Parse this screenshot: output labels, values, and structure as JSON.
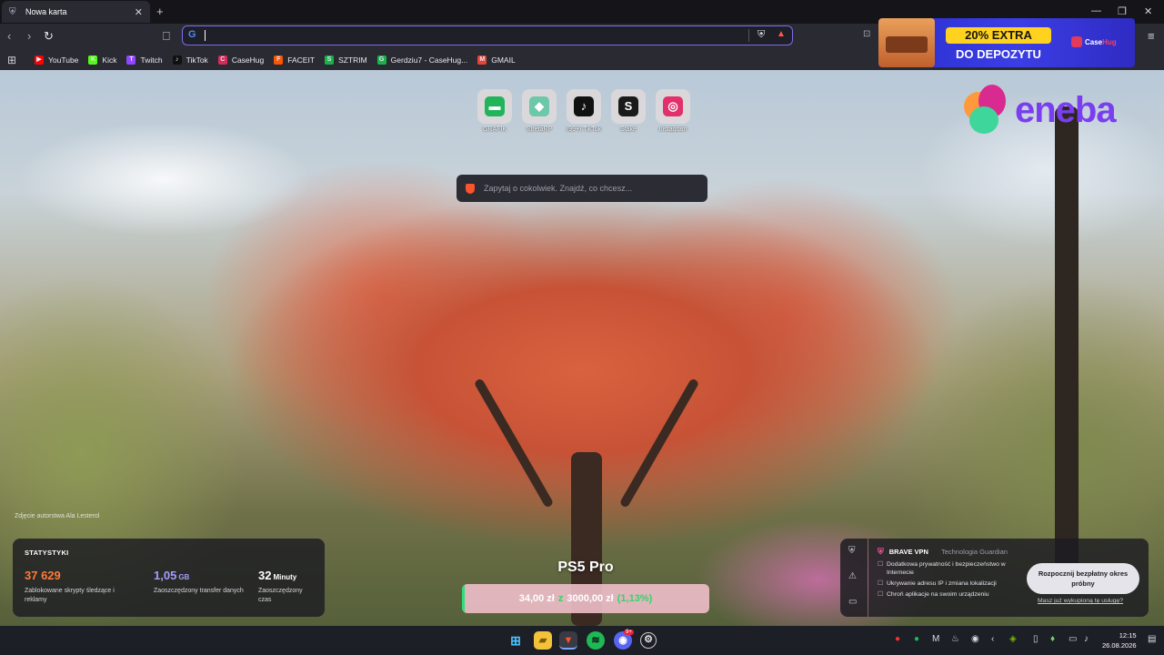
{
  "tab": {
    "title": "Nowa karta",
    "close": "✕",
    "new": "+"
  },
  "window": {
    "minimize": "—",
    "maximize": "❐",
    "close": "✕"
  },
  "bookmarks": [
    {
      "label": "YouTube",
      "color": "#ff0000",
      "glyph": "▶"
    },
    {
      "label": "Kick",
      "color": "#53fc18",
      "glyph": "K"
    },
    {
      "label": "Twitch",
      "color": "#9146ff",
      "glyph": "T"
    },
    {
      "label": "TikTok",
      "color": "#111111",
      "glyph": "♪"
    },
    {
      "label": "CaseHug",
      "color": "#d62a5a",
      "glyph": "C"
    },
    {
      "label": "FACEIT",
      "color": "#ff5500",
      "glyph": "F"
    },
    {
      "label": "SZTRIM",
      "color": "#19b34a",
      "glyph": "S"
    },
    {
      "label": "Gerdziu7 - CaseHug...",
      "color": "#19b34a",
      "glyph": "G"
    },
    {
      "label": "GMAIL",
      "color": "#ea4335",
      "glyph": "M"
    }
  ],
  "ad": {
    "badge": "20% EXTRA",
    "sub": "DO DEPOZYTU",
    "brand": "Case",
    "brand_hl": "Hug"
  },
  "eneba": {
    "word": "eneba"
  },
  "top_sites": [
    {
      "label": "GRAFIK",
      "color": "#21b45a",
      "glyph": "▬"
    },
    {
      "label": "StrefaRP",
      "color": "#6cc8a8",
      "glyph": "◆"
    },
    {
      "label": "(99+) TikTok",
      "color": "#111111",
      "glyph": "♪"
    },
    {
      "label": "Stake",
      "color": "#1a1a1a",
      "glyph": "S"
    },
    {
      "label": "Instagram",
      "color": "#e1306c",
      "glyph": "◎"
    }
  ],
  "search": {
    "placeholder": "Zapytaj o cokolwiek. Znajdź, co chcesz..."
  },
  "photo_credit": "Zdjęcie autorstwa Ala Lesterol",
  "stats": {
    "title": "STATYSTYKI",
    "items": [
      {
        "value": "37 629",
        "unit": "",
        "desc": "Zablokowane skrypty śledzące i reklamy",
        "color": "#ff7a3a"
      },
      {
        "value": "1,05",
        "unit": "GB",
        "desc": "Zaoszczędzony transfer danych",
        "color": "#a59cff"
      },
      {
        "value": "32",
        "unit": "Minuty",
        "desc": "Zaoszczędzony czas",
        "color": "#ffffff"
      }
    ]
  },
  "ps5": {
    "title": "PS5 Pro",
    "current": "34,00 zł",
    "z": "z",
    "target": "3000,00 zł",
    "percent": "(1,13%)",
    "progress_fraction": 0.0113
  },
  "vpn": {
    "name": "BRAVE VPN",
    "tech": "Technologia  Guardian",
    "items": [
      "Dodatkowa prywatność i bezpieczeństwo w Internecie",
      "Ukrywanie adresu IP i zmiana lokalizacji",
      "Chroń aplikacje na swoim urządzeniu"
    ],
    "cta": "Rozpocznij bezpłatny okres próbny",
    "link": "Masz już wykupioną tę usługę?"
  },
  "clock": {
    "time": "12:15",
    "date": "26.08.2026"
  },
  "discord_badge": "9+"
}
